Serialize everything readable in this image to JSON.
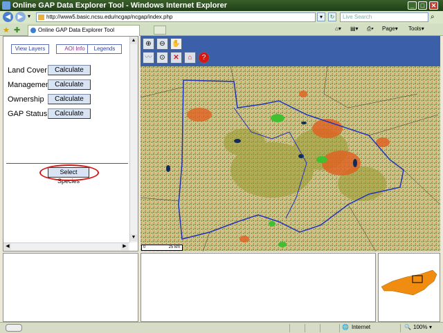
{
  "window": {
    "title": "Online GAP Data Explorer Tool - Windows Internet Explorer",
    "min_label": "_",
    "max_label": "□",
    "close_label": "✕"
  },
  "browser": {
    "url": "http://www5.basic.ncsu.edu/ncgap/ncgap/index.php",
    "search_placeholder": "Live Search",
    "tab_title": "Online GAP Data Explorer Tool",
    "cmd_page": "Page",
    "cmd_tools": "Tools"
  },
  "left_panel": {
    "tabs": [
      "View Layers",
      "AOI Info",
      "Legends"
    ],
    "active_tab": "AOI Info",
    "rows": [
      {
        "label": "Land Cover",
        "button": "Calculate"
      },
      {
        "label": "Management",
        "button": "Calculate"
      },
      {
        "label": "Ownership",
        "button": "Calculate"
      },
      {
        "label": "GAP Status",
        "button": "Calculate"
      }
    ],
    "select_species": "Select Species"
  },
  "map_tools": {
    "row1": [
      "zoom-in-icon",
      "zoom-out-icon",
      "pan-hand-icon"
    ],
    "row2": [
      "measure-icon",
      "zoom-extent-icon",
      "clear-icon",
      "home-icon",
      "help-icon"
    ]
  },
  "scale": {
    "left": "0",
    "right": "25 km"
  },
  "status": {
    "zone": "Internet",
    "zoom": "100%"
  },
  "colors": {
    "accent": "#3b5fa8",
    "highlight": "#d41818",
    "boundary": "#2233bb"
  }
}
